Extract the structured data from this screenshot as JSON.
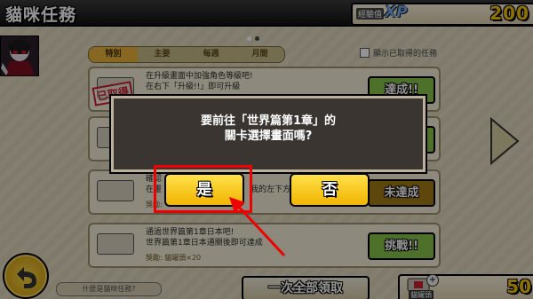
{
  "header": {
    "title": "貓咪任務",
    "xp_label": "經驗值",
    "xp_tag": "XP",
    "xp_value": "200"
  },
  "tabs": [
    {
      "label": "特別",
      "active": true
    },
    {
      "label": "主要",
      "active": false
    },
    {
      "label": "每週",
      "active": false
    },
    {
      "label": "月間",
      "active": false
    }
  ],
  "filter": {
    "show_owned_label": "顯示已取得的任務"
  },
  "missions": [
    {
      "line1": "在升級畫面中加強角色等級吧!",
      "line2": "在右下「升級!!」即可升級",
      "reward": "",
      "stamp": "已取得",
      "button": "達成!!",
      "button_color": "#86c34a"
    },
    {
      "line1": "",
      "line2": "",
      "reward": "",
      "stamp": "",
      "button": "",
      "button_color": "#86c34a"
    },
    {
      "line1": "確認",
      "line2": "在畫",
      "line2_tail": "我的左下方!",
      "reward": "獎勵:",
      "stamp": "",
      "button": "未達成",
      "button_color": "#a07a18"
    },
    {
      "line1": "通過世界篇第1章日本吧!",
      "line2": "世界篇第1章日本通關後即可達成",
      "reward": "獎勵: 貓罐頭×20",
      "stamp": "",
      "button": "挑戰!!",
      "button_color": "#86c34a"
    }
  ],
  "dialog": {
    "line1": "要前往「世界篇第1章」的",
    "line2": "關卡選擇畫面嗎?",
    "yes": "是",
    "no": "否"
  },
  "footer": {
    "help": "什麼是貓咪任務?",
    "claim_all": "一次全部領取",
    "can_label": "貓罐頭",
    "can_value": "50"
  },
  "colors": {
    "accent_yellow": "#f2b400",
    "highlight_red": "#e00000",
    "dialog_bg": "#3a3530"
  }
}
